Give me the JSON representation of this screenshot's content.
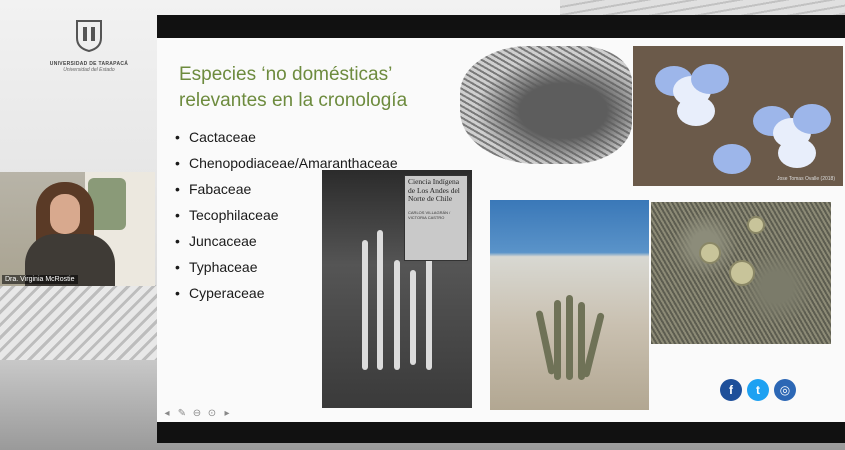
{
  "university": {
    "name": "UNIVERSIDAD DE TARAPACÁ",
    "tagline": "Universidad del Estado"
  },
  "webcam": {
    "participant_name": "Dra. Virginia McRostie"
  },
  "slide": {
    "title": "Especies ‘no domésticas’ relevantes en la cronología",
    "bullets": [
      "Cactaceae",
      "Chenopodiaceae/Amaranthaceae",
      "Fabaceae",
      "Tecophilaceae",
      "Juncaceae",
      "Typhaceae",
      "Cyperaceae"
    ],
    "book_cover_title": "Ciencia Indígena de Los Andes del Norte de Chile",
    "book_cover_author": "CARLOS VILLAGRÁN / VICTORIA CASTRO",
    "photo_credit": "Jose Tomas Ovalle (2018)",
    "title_color": "#6d8b3e"
  },
  "social": {
    "icons": [
      "facebook-icon",
      "twitter-icon",
      "instagram-icon"
    ],
    "facebook_glyph": "f",
    "twitter_glyph": "t",
    "instagram_glyph": "◎"
  },
  "presenter_toolbar": {
    "icons": [
      "previous-icon",
      "pen-icon",
      "zoom-icon",
      "more-icon",
      "next-icon"
    ],
    "glyphs": [
      "◂",
      "✎",
      "⊖",
      "⊙",
      "▸"
    ]
  }
}
